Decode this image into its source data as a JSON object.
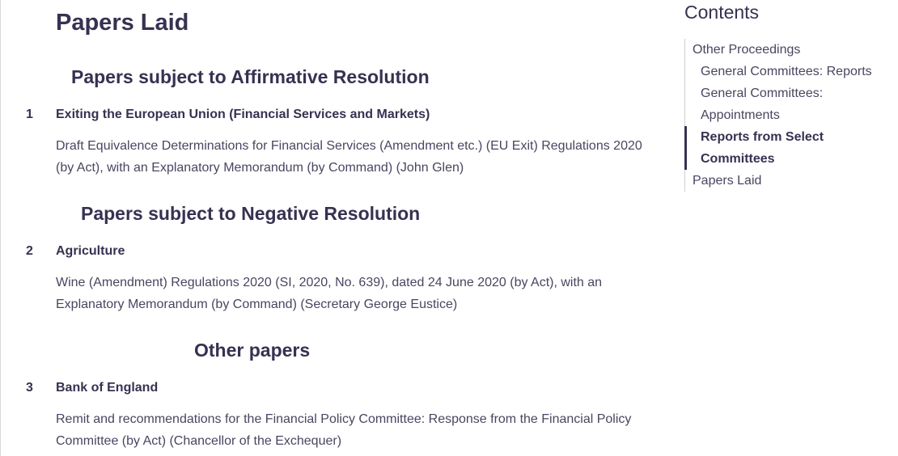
{
  "page_title": "Papers Laid",
  "sections": [
    {
      "heading": "Papers subject to Affirmative Resolution",
      "item": {
        "number": "1",
        "title": "Exiting the European Union (Financial Services and Markets)",
        "description": "Draft Equivalence Determinations for Financial Services (Amendment etc.) (EU Exit) Regulations 2020 (by Act), with an Explanatory Memorandum (by Command) (John Glen)"
      }
    },
    {
      "heading": "Papers subject to Negative Resolution",
      "item": {
        "number": "2",
        "title": "Agriculture",
        "description": "Wine (Amendment) Regulations 2020 (SI, 2020, No. 639), dated 24 June 2020 (by Act), with an Explanatory Memorandum (by Command) (Secretary George Eustice)"
      }
    },
    {
      "heading": "Other papers",
      "item": {
        "number": "3",
        "title": "Bank of England",
        "description": "Remit and recommendations for the Financial Policy Committee: Response from the Financial Policy Committee (by Act) (Chancellor of the Exchequer)"
      }
    }
  ],
  "contents": {
    "title": "Contents",
    "items": [
      {
        "label": "Other Proceedings"
      },
      {
        "label": "General Committees: Reports"
      },
      {
        "label": "General Committees: Appointments"
      },
      {
        "label": "Reports from Select Committees"
      },
      {
        "label": "Papers Laid"
      }
    ]
  },
  "colors": {
    "text": "#373151",
    "active_marker": "#373151"
  }
}
